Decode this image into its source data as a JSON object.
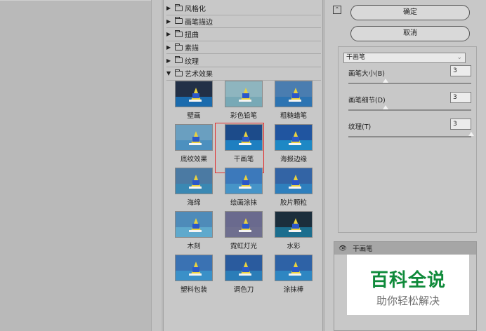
{
  "categories": [
    {
      "label": "风格化",
      "expanded": false
    },
    {
      "label": "画笔描边",
      "expanded": false
    },
    {
      "label": "扭曲",
      "expanded": false
    },
    {
      "label": "素描",
      "expanded": false
    },
    {
      "label": "纹理",
      "expanded": false
    },
    {
      "label": "艺术效果",
      "expanded": true
    }
  ],
  "filters": [
    {
      "label": "壁画",
      "sky": "#223047",
      "sea": "#1b6bad",
      "selected": false
    },
    {
      "label": "彩色铅笔",
      "sky": "#8eb5bf",
      "sea": "#78a9b6",
      "selected": false
    },
    {
      "label": "粗糙蜡笔",
      "sky": "#4a7db0",
      "sea": "#2d74b2",
      "selected": false
    },
    {
      "label": "底纹效果",
      "sky": "#6a9fc0",
      "sea": "#4c90bf",
      "selected": false
    },
    {
      "label": "干画笔",
      "sky": "#1c4b8a",
      "sea": "#1e7fc1",
      "selected": true
    },
    {
      "label": "海报边缘",
      "sky": "#2055a0",
      "sea": "#1d88c5",
      "selected": false
    },
    {
      "label": "海绵",
      "sky": "#4b7aa3",
      "sea": "#3a88b3",
      "selected": false
    },
    {
      "label": "绘画涂抹",
      "sky": "#3c79bb",
      "sea": "#4694c8",
      "selected": false
    },
    {
      "label": "胶片颗粒",
      "sky": "#3364a5",
      "sea": "#2e7fbd",
      "selected": false
    },
    {
      "label": "木刻",
      "sky": "#4e8bb9",
      "sea": "#5fa9cc",
      "selected": false
    },
    {
      "label": "霓虹灯光",
      "sky": "#6a6a8e",
      "sea": "#6f6f8f",
      "selected": false
    },
    {
      "label": "水彩",
      "sky": "#1b2e3c",
      "sea": "#1c6e8e",
      "selected": false
    },
    {
      "label": "塑料包装",
      "sky": "#3a72b3",
      "sea": "#3a90c8",
      "selected": false
    },
    {
      "label": "调色刀",
      "sky": "#2a5b9e",
      "sea": "#2b7db8",
      "selected": false
    },
    {
      "label": "涂抹棒",
      "sky": "#2e62a6",
      "sea": "#2e86c2",
      "selected": false
    }
  ],
  "buttons": {
    "ok": "确定",
    "cancel": "取消",
    "collapse_icon": "chevron-up-icon"
  },
  "filter_select": {
    "value": "干画笔"
  },
  "params": [
    {
      "label": "画笔大小(B)",
      "value": "3",
      "level": 0.3
    },
    {
      "label": "画笔细节(D)",
      "value": "3",
      "level": 0.3
    },
    {
      "label": "纹理(T)",
      "value": "3",
      "level": 1.0
    }
  ],
  "layer": {
    "label": "干画笔",
    "visibility_icon": "eye-icon"
  },
  "watermark": {
    "title": "百科全说",
    "subtitle": "助你轻松解决"
  }
}
